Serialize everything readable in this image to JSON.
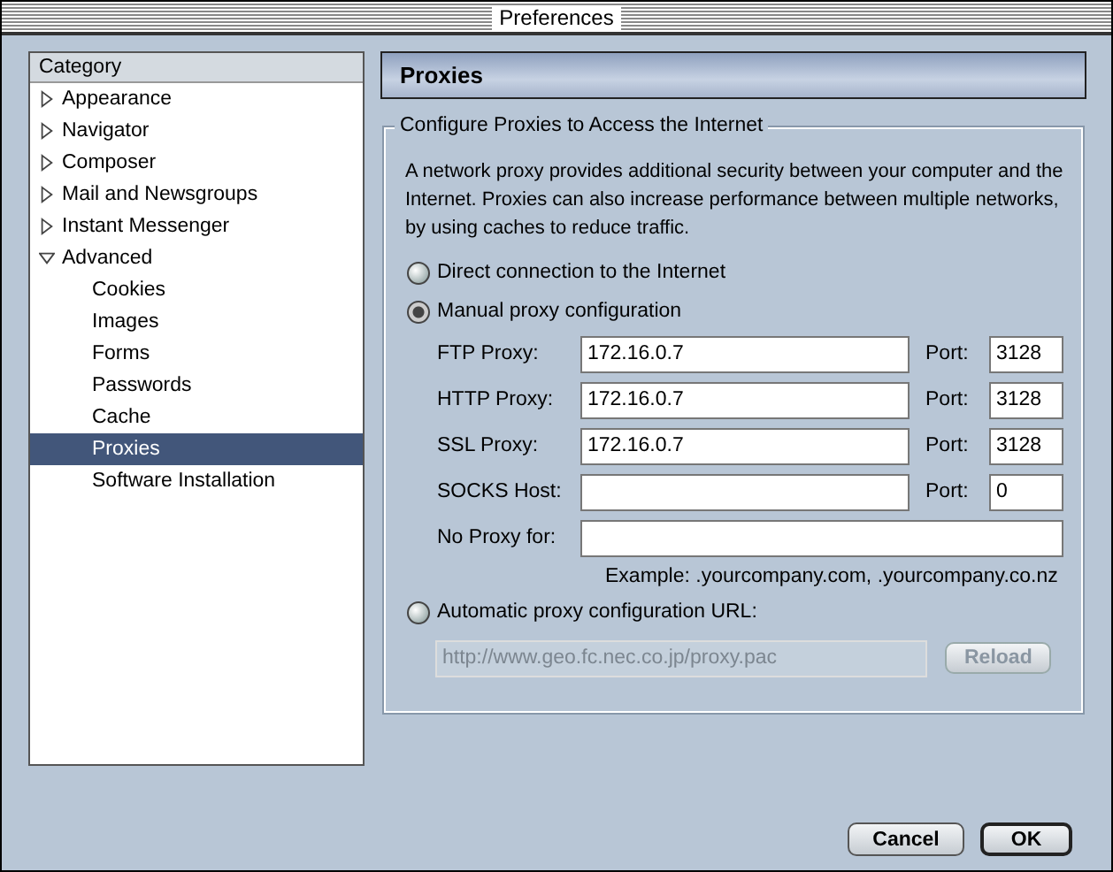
{
  "window": {
    "title": "Preferences"
  },
  "sidebar": {
    "header": "Category",
    "items": [
      {
        "label": "Appearance",
        "expanded": false,
        "selected": false
      },
      {
        "label": "Navigator",
        "expanded": false,
        "selected": false
      },
      {
        "label": "Composer",
        "expanded": false,
        "selected": false
      },
      {
        "label": "Mail and Newsgroups",
        "expanded": false,
        "selected": false
      },
      {
        "label": "Instant Messenger",
        "expanded": false,
        "selected": false
      },
      {
        "label": "Advanced",
        "expanded": true,
        "selected": false,
        "children": [
          {
            "label": "Cookies",
            "selected": false
          },
          {
            "label": "Images",
            "selected": false
          },
          {
            "label": "Forms",
            "selected": false
          },
          {
            "label": "Passwords",
            "selected": false
          },
          {
            "label": "Cache",
            "selected": false
          },
          {
            "label": "Proxies",
            "selected": true
          },
          {
            "label": "Software Installation",
            "selected": false
          }
        ]
      }
    ]
  },
  "panel": {
    "title": "Proxies",
    "group_title": "Configure Proxies to Access the Internet",
    "description": "A network proxy provides additional security between your computer and the Internet. Proxies can also increase performance between multiple networks, by using caches to reduce traffic.",
    "direct_option": {
      "label": "Direct connection to the Internet",
      "selected": false
    },
    "manual_option": {
      "label": "Manual proxy configuration",
      "selected": true
    },
    "proxies": [
      {
        "label": "FTP Proxy:",
        "value": "172.16.0.7",
        "port_label": "Port:",
        "port": "3128"
      },
      {
        "label": "HTTP Proxy:",
        "value": "172.16.0.7",
        "port_label": "Port:",
        "port": "3128"
      },
      {
        "label": "SSL Proxy:",
        "value": "172.16.0.7",
        "port_label": "Port:",
        "port": "3128"
      },
      {
        "label": "SOCKS Host:",
        "port_label": "Port:",
        "port": "0"
      }
    ],
    "no_proxy": {
      "label": "No Proxy for:"
    },
    "example": "Example: .yourcompany.com, .yourcompany.co.nz",
    "auto_option": {
      "label": "Automatic proxy configuration URL:",
      "selected": false
    },
    "auto_url": {
      "value": "http://www.geo.fc.nec.co.jp/proxy.pac",
      "disabled": true
    },
    "reload": {
      "label": "Reload",
      "disabled": true
    }
  },
  "buttons": [
    {
      "label": "Cancel",
      "default": false
    },
    {
      "label": "OK",
      "default": true
    }
  ]
}
